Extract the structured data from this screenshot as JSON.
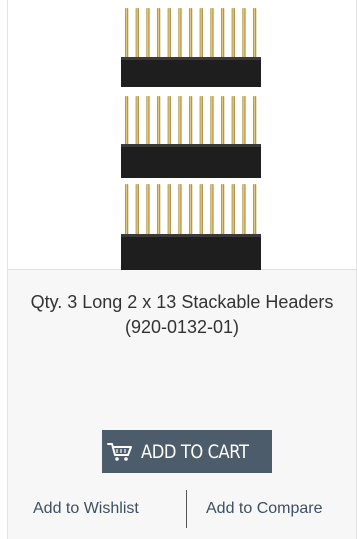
{
  "product": {
    "title": "Qty. 3 Long 2 x 13 Stackable Headers (920-0132-01)",
    "image_alt": "Stackable headers product image"
  },
  "actions": {
    "add_to_cart_label": "ADD TO CART",
    "add_to_wishlist_label": "Add to Wishlist",
    "add_to_compare_label": "Add to Compare"
  },
  "colors": {
    "cart_button_bg": "#4d5c6a",
    "link_color": "#3d4f63",
    "card_bg": "#f7f7f7"
  },
  "icons": {
    "cart": "cart-icon"
  }
}
